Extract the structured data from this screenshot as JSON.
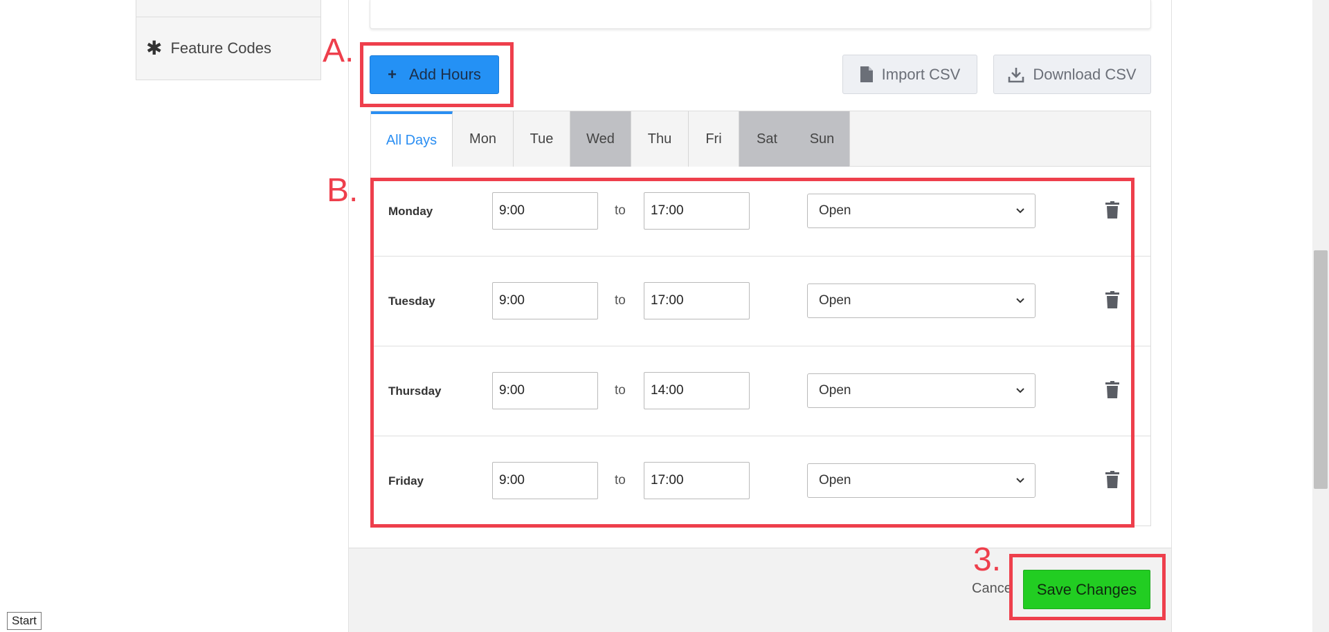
{
  "sidebar": {
    "items": [
      {
        "label": "Feature Codes",
        "icon": "asterisk-icon"
      }
    ]
  },
  "toolbar": {
    "add_hours_label": "Add Hours",
    "import_csv_label": "Import CSV",
    "download_csv_label": "Download CSV"
  },
  "tabs": [
    {
      "label": "All Days",
      "state": "active"
    },
    {
      "label": "Mon",
      "state": "normal"
    },
    {
      "label": "Tue",
      "state": "normal"
    },
    {
      "label": "Wed",
      "state": "shaded"
    },
    {
      "label": "Thu",
      "state": "normal"
    },
    {
      "label": "Fri",
      "state": "normal"
    },
    {
      "label": "Sat",
      "state": "shaded"
    },
    {
      "label": "Sun",
      "state": "shaded"
    }
  ],
  "hours": [
    {
      "day": "Monday",
      "from": "9:00",
      "to_word": "to",
      "until": "17:00",
      "status": "Open"
    },
    {
      "day": "Tuesday",
      "from": "9:00",
      "to_word": "to",
      "until": "17:00",
      "status": "Open"
    },
    {
      "day": "Thursday",
      "from": "9:00",
      "to_word": "to",
      "until": "14:00",
      "status": "Open"
    },
    {
      "day": "Friday",
      "from": "9:00",
      "to_word": "to",
      "until": "17:00",
      "status": "Open"
    }
  ],
  "footer": {
    "cancel_label": "Cance",
    "save_label": "Save Changes"
  },
  "annotations": {
    "a": "A.",
    "b": "B.",
    "c": "3."
  },
  "taskbar": {
    "start_label": "Start"
  },
  "colors": {
    "primary": "#2491f5",
    "save": "#22cd22",
    "annotation": "#ee3f4c",
    "active_tab": "#2a8ef2"
  }
}
